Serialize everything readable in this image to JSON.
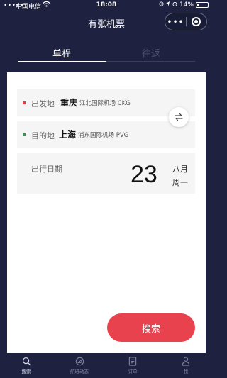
{
  "status": {
    "carrier": "中国电信",
    "time": "18:08",
    "battery_text": "14%",
    "battery_level": 0.14
  },
  "nav": {
    "title": "有张机票",
    "more_icon": "more-dots-icon",
    "close_icon": "close-circle-icon"
  },
  "tabs": [
    {
      "label": "单程",
      "active": true
    },
    {
      "label": "往返",
      "active": false
    }
  ],
  "form": {
    "from": {
      "label": "出发地",
      "city": "重庆",
      "airport": "江北国际机场 CKG"
    },
    "to": {
      "label": "目的地",
      "city": "上海",
      "airport": "浦东国际机场 PVG"
    },
    "date": {
      "label": "出行日期",
      "day": "23",
      "month": "八月",
      "weekday": "周一"
    },
    "swap_icon": "swap-icon"
  },
  "search_button": "搜索",
  "tabbar": [
    {
      "label": "搜索",
      "icon": "search-icon",
      "active": true
    },
    {
      "label": "航班动态",
      "icon": "plane-icon",
      "active": false
    },
    {
      "label": "订单",
      "icon": "order-icon",
      "active": false
    },
    {
      "label": "我",
      "icon": "user-icon",
      "active": false
    }
  ],
  "colors": {
    "background": "#1e2240",
    "accent": "#e8424e",
    "from_dot": "#e53c48",
    "to_dot": "#3f8f5a"
  }
}
